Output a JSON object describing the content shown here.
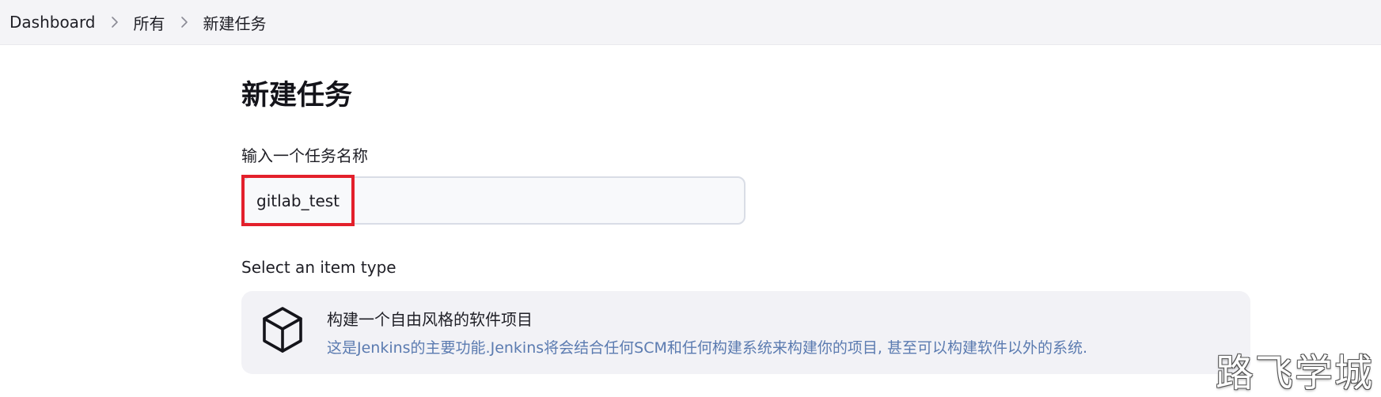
{
  "breadcrumb": {
    "items": [
      {
        "label": "Dashboard"
      },
      {
        "label": "所有"
      },
      {
        "label": "新建任务"
      }
    ],
    "separator_icon": "chevron-right-icon"
  },
  "page": {
    "title": "新建任务"
  },
  "name_field": {
    "label": "输入一个任务名称",
    "value": "gitlab_test"
  },
  "item_type": {
    "section_label": "Select an item type",
    "options": [
      {
        "icon": "cube-icon",
        "title": "构建一个自由风格的软件项目",
        "description": "这是Jenkins的主要功能.Jenkins将会结合任何SCM和任何构建系统来构建你的项目, 甚至可以构建软件以外的系统."
      }
    ]
  },
  "watermark": {
    "text": "路飞学城"
  },
  "colors": {
    "highlight": "#e3202b",
    "description_text": "#5b7bb0",
    "card_background": "#f2f2f6",
    "breadcrumb_background": "#f4f4f7"
  }
}
